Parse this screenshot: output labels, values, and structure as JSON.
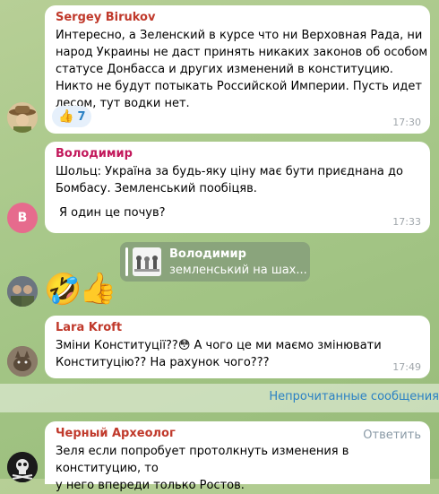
{
  "messages": [
    {
      "author": "Sergey Birukov",
      "author_color": "#c0392b",
      "lines": [
        "Интересно, а Зеленский в курсе что ни Верховная Рада, ни",
        "народ Украины не даст принять никаких законов об особом",
        "статусе Донбасса и других изменений в конституцию.",
        "Никто не будут потыкать Российской Империи. Пусть идет",
        "лесом, тут водки нет."
      ],
      "reaction_emoji": "👍",
      "reaction_count": "7",
      "time": "17:30"
    },
    {
      "author": "Володимир",
      "author_color": "#c2185b",
      "lines": [
        "Шольц: Україна за будь-яку ціну має бути приєднана до",
        "Бомбасу. Земленський пообіцяв.",
        "",
        "Я один це почув?"
      ],
      "avatar_letter": "B",
      "avatar_color": "#e66b8d",
      "time": "17:33"
    },
    {
      "forward_author": "Володимир",
      "forward_preview": "земленський на шах...",
      "sticker_1": "🤣",
      "sticker_2": "👍"
    },
    {
      "author": "Lara Kroft",
      "author_color": "#c0392b",
      "lines": [
        "Зміни Конституції??😳 А чого це ми маємо змінювати",
        "Конституцію?? На рахунок чого???"
      ],
      "time": "17:49"
    },
    {
      "author": "Черный Археолог",
      "author_color": "#c0392b",
      "reply_label": "Ответить",
      "lines": [
        "Зеля если попробует протолкнуть изменения в конституцию, то",
        "у него впереди только Ростов."
      ]
    }
  ],
  "unread_label": "Непрочитанные сообщения"
}
